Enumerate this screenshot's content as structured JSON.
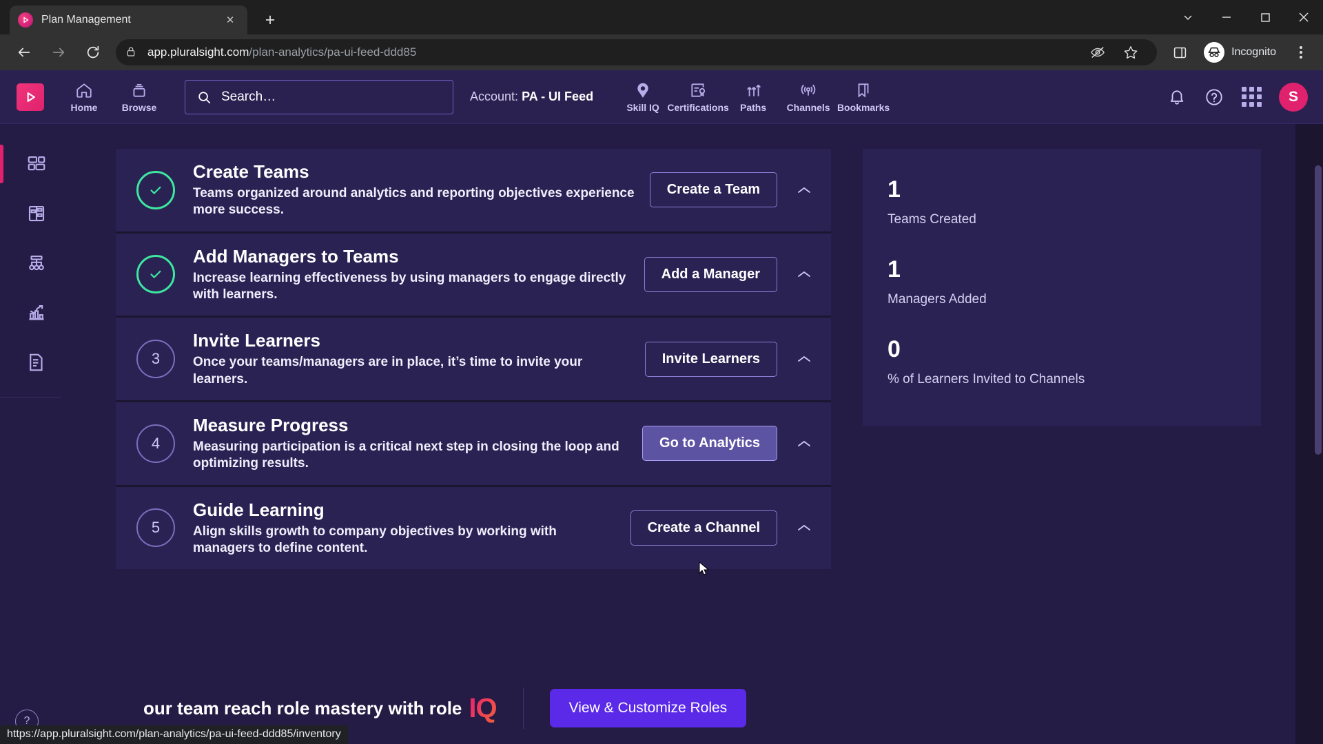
{
  "browser": {
    "tab": {
      "title": "Plan Management",
      "close_label": "×",
      "favicon": "pluralsight-icon"
    },
    "new_tab_label": "+",
    "window_controls": [
      "chevron-down",
      "minimize",
      "maximize",
      "close"
    ],
    "nav": {
      "back": "back-icon",
      "forward": "forward-icon",
      "reload": "reload-icon"
    },
    "omnibox": {
      "lock": "lock-icon",
      "url_domain": "app.pluralsight.com",
      "url_path": "/plan-analytics/pa-ui-feed-ddd85",
      "eye_icon": "eye-off-icon",
      "bookmark_icon": "star-icon"
    },
    "side_panel_icon": "side-panel-icon",
    "profile": {
      "label": "Incognito",
      "icon": "incognito-icon"
    },
    "menu_icon": "kebab-menu-icon",
    "status_url": "https://app.pluralsight.com/plan-analytics/pa-ui-feed-ddd85/inventory"
  },
  "topnav": {
    "logo": "pluralsight-logo",
    "items": [
      {
        "label": "Home",
        "icon": "home-icon"
      },
      {
        "label": "Browse",
        "icon": "browse-icon"
      }
    ],
    "search": {
      "placeholder": "Search…",
      "value": "",
      "icon": "search-icon"
    },
    "account": {
      "key": "Account:",
      "value": "PA - UI Feed"
    },
    "links": [
      {
        "label": "Skill IQ",
        "icon": "skilliq-icon"
      },
      {
        "label": "Certifications",
        "icon": "certificate-icon"
      },
      {
        "label": "Paths",
        "icon": "paths-icon"
      },
      {
        "label": "Channels",
        "icon": "channels-icon"
      },
      {
        "label": "Bookmarks",
        "icon": "bookmark-icon"
      }
    ],
    "right": {
      "notifications": "bell-icon",
      "help": "help-icon",
      "apps": "app-grid-icon",
      "avatar_initial": "S"
    }
  },
  "sidebar": {
    "items": [
      {
        "name": "dashboard",
        "icon": "dashboard-icon",
        "active": true
      },
      {
        "name": "plan",
        "icon": "plan-icon",
        "active": false
      },
      {
        "name": "teams",
        "icon": "org-chart-icon",
        "active": false
      },
      {
        "name": "analytics",
        "icon": "analytics-icon",
        "active": false
      },
      {
        "name": "reports",
        "icon": "reports-icon",
        "active": false
      }
    ],
    "help_label": "?"
  },
  "steps": [
    {
      "status": "done",
      "badge": "✓",
      "title": "Create Teams",
      "desc": "Teams organized around analytics and reporting objectives experience more success.",
      "button": "Create a Team",
      "hover": false,
      "chevron": "chevron-up-icon"
    },
    {
      "status": "done",
      "badge": "✓",
      "title": "Add Managers to Teams",
      "desc": "Increase learning effectiveness by using managers to engage directly with learners.",
      "button": "Add a Manager",
      "hover": false,
      "chevron": "chevron-up-icon"
    },
    {
      "status": "todo",
      "badge": "3",
      "title": "Invite Learners",
      "desc": "Once your teams/managers are in place, it’s time to invite your learners.",
      "button": "Invite Learners",
      "hover": false,
      "chevron": "chevron-up-icon"
    },
    {
      "status": "todo",
      "badge": "4",
      "title": "Measure Progress",
      "desc": "Measuring participation is a critical next step in closing the loop and optimizing results.",
      "button": "Go to Analytics",
      "hover": true,
      "chevron": "chevron-up-icon"
    },
    {
      "status": "todo",
      "badge": "5",
      "title": "Guide Learning",
      "desc": "Align skills growth to company objectives by working with managers to define content.",
      "button": "Create a Channel",
      "hover": false,
      "chevron": "chevron-up-icon"
    }
  ],
  "stats": [
    {
      "value": "1",
      "label": "Teams Created"
    },
    {
      "value": "1",
      "label": "Managers Added"
    },
    {
      "value": "0",
      "label": "% of Learners Invited to Channels"
    }
  ],
  "banner": {
    "text_prefix": "our team reach role mastery with role",
    "iq": "IQ",
    "button": "View & Customize Roles"
  },
  "colors": {
    "accent_pink": "#e0226e",
    "purple_bg": "#241c45",
    "card_bg": "#2b2254",
    "page_bg": "#1b1530",
    "success_green": "#3ce8a0",
    "button_purple": "#5b29e8"
  }
}
